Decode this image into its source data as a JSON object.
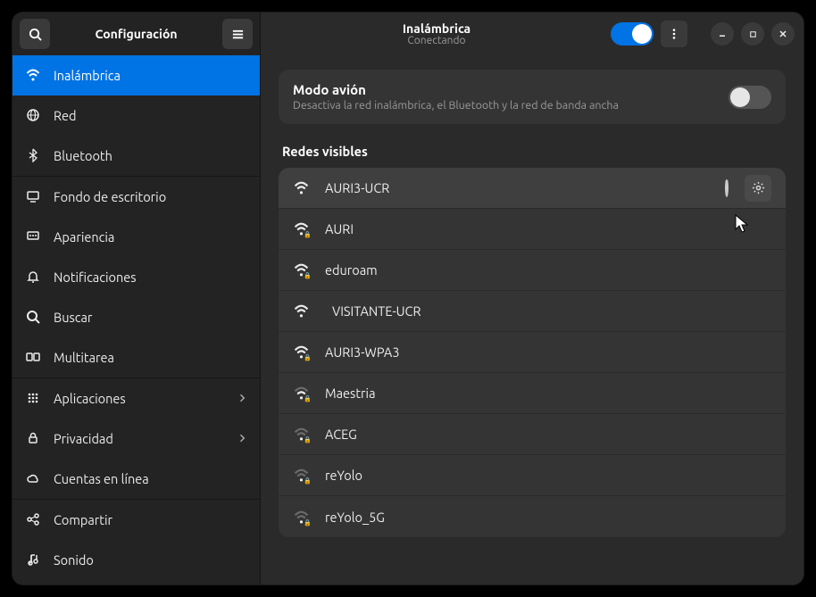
{
  "sidebar": {
    "title": "Configuración",
    "items": [
      {
        "label": "Inalámbrica",
        "icon": "wifi",
        "name": "sidebar-item-wireless",
        "active": true
      },
      {
        "label": "Red",
        "icon": "globe",
        "name": "sidebar-item-network"
      },
      {
        "label": "Bluetooth",
        "icon": "bluetooth",
        "name": "sidebar-item-bluetooth"
      },
      {
        "label": "Fondo de escritorio",
        "icon": "display",
        "name": "sidebar-item-background"
      },
      {
        "label": "Apariencia",
        "icon": "appearance",
        "name": "sidebar-item-appearance"
      },
      {
        "label": "Notificaciones",
        "icon": "bell",
        "name": "sidebar-item-notifications"
      },
      {
        "label": "Buscar",
        "icon": "search",
        "name": "sidebar-item-search"
      },
      {
        "label": "Multitarea",
        "icon": "multitask",
        "name": "sidebar-item-multitask"
      },
      {
        "label": "Aplicaciones",
        "icon": "apps",
        "name": "sidebar-item-apps",
        "chevron": true
      },
      {
        "label": "Privacidad",
        "icon": "lock",
        "name": "sidebar-item-privacy",
        "chevron": true
      },
      {
        "label": "Cuentas en línea",
        "icon": "cloud",
        "name": "sidebar-item-accounts"
      },
      {
        "label": "Compartir",
        "icon": "share",
        "name": "sidebar-item-share"
      },
      {
        "label": "Sonido",
        "icon": "sound",
        "name": "sidebar-item-sound"
      }
    ]
  },
  "header": {
    "title": "Inalámbrica",
    "subtitle": "Conectando"
  },
  "airplane": {
    "title": "Modo avión",
    "subtitle": "Desactiva la red inalámbrica, el Bluetooth y la red de banda ancha"
  },
  "networks": {
    "title": "Redes visibles",
    "list": [
      {
        "name": "AURI3-UCR",
        "strength": "full",
        "secure": false,
        "connecting": true,
        "active": true
      },
      {
        "name": "AURI",
        "strength": "full",
        "secure": true
      },
      {
        "name": "eduroam",
        "strength": "full",
        "secure": true
      },
      {
        "name": "VISITANTE-UCR",
        "strength": "full",
        "secure": false,
        "indent": true
      },
      {
        "name": "AURI3-WPA3",
        "strength": "full",
        "secure": true
      },
      {
        "name": "Maestria",
        "strength": "mid",
        "secure": true
      },
      {
        "name": "ACEG",
        "strength": "low",
        "secure": true
      },
      {
        "name": "reYolo",
        "strength": "low",
        "secure": true
      },
      {
        "name": "reYolo_5G",
        "strength": "low",
        "secure": true
      }
    ]
  }
}
